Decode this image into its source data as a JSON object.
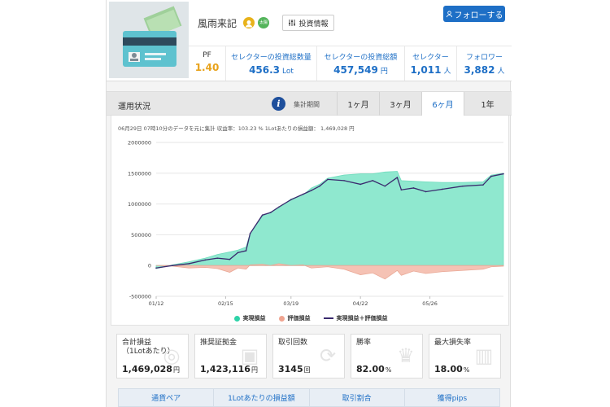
{
  "profile": {
    "name": "風雨来記",
    "badge2_text": "太陽光",
    "invest_info_label": "投資情報",
    "follow_label": "フォローする"
  },
  "stats": [
    {
      "label": "PF",
      "value": "1.40",
      "unit": ""
    },
    {
      "label": "セレクターの投資総数量",
      "value": "456.3",
      "unit": "Lot"
    },
    {
      "label": "セレクターの投資総額",
      "value": "457,549",
      "unit": "円"
    },
    {
      "label": "セレクター",
      "value": "1,011",
      "unit": "人"
    },
    {
      "label": "フォロワー",
      "value": "3,882",
      "unit": "人"
    }
  ],
  "status": {
    "title": "運用状況",
    "period_label": "集計期間",
    "tabs": [
      "1ヶ月",
      "3ヶ月",
      "6ヶ月",
      "1年"
    ],
    "active_tab": "6ヶ月"
  },
  "chart_note": "06月29日 07時10分のデータを元に集計 収益率：103.23 % 1Lotあたりの損益額： 1,469,028 円",
  "colors": {
    "realized": "#8fe8cf",
    "unrealized": "#f5c2b4",
    "combined_line": "#3a2a6e",
    "accent": "#1e6fc6"
  },
  "chart_data": {
    "type": "area",
    "title": "",
    "xlabel": "",
    "ylabel": "",
    "ylim": [
      -500000,
      2000000
    ],
    "y_ticks": [
      "2000000",
      "1500000",
      "1000000",
      "500000",
      "0",
      "-500000"
    ],
    "x_ticks": [
      "01/12",
      "02/15",
      "03/19",
      "04/22",
      "05/26"
    ],
    "x_tick_days": [
      0,
      34,
      66,
      100,
      134
    ],
    "x_range_days": [
      0,
      170
    ],
    "legend_position": "bottom",
    "series": [
      {
        "name": "実現損益",
        "kind": "area",
        "x": [
          0,
          8,
          16,
          24,
          30,
          36,
          40,
          44,
          46,
          52,
          56,
          60,
          66,
          72,
          76,
          80,
          84,
          92,
          100,
          106,
          112,
          118,
          120,
          126,
          132,
          140,
          150,
          160,
          164,
          170
        ],
        "y": [
          -50000,
          10000,
          60000,
          120000,
          180000,
          220000,
          250000,
          300000,
          520000,
          800000,
          870000,
          930000,
          1080000,
          1150000,
          1260000,
          1320000,
          1420000,
          1470000,
          1490000,
          1490000,
          1520000,
          1530000,
          1380000,
          1370000,
          1360000,
          1350000,
          1350000,
          1360000,
          1470000,
          1500000
        ]
      },
      {
        "name": "評価損益",
        "kind": "area",
        "x": [
          0,
          8,
          16,
          24,
          30,
          36,
          40,
          44,
          46,
          52,
          56,
          60,
          66,
          72,
          76,
          80,
          84,
          92,
          100,
          106,
          112,
          118,
          120,
          126,
          132,
          140,
          150,
          160,
          164,
          170
        ],
        "y": [
          0,
          -10000,
          -40000,
          -30000,
          -50000,
          -110000,
          -40000,
          -60000,
          10000,
          20000,
          0,
          30000,
          0,
          10000,
          -40000,
          -30000,
          -20000,
          -60000,
          -150000,
          -120000,
          -220000,
          -80000,
          -160000,
          -90000,
          -130000,
          -100000,
          -80000,
          -60000,
          -20000,
          -10000
        ]
      },
      {
        "name": "実現損益＋評価損益",
        "kind": "line",
        "x": [
          0,
          8,
          16,
          24,
          30,
          36,
          40,
          44,
          46,
          52,
          56,
          60,
          66,
          72,
          76,
          80,
          84,
          92,
          100,
          106,
          112,
          118,
          120,
          126,
          132,
          140,
          150,
          160,
          164,
          170
        ],
        "y": [
          -40000,
          0,
          30000,
          90000,
          120000,
          100000,
          210000,
          240000,
          520000,
          820000,
          860000,
          950000,
          1070000,
          1160000,
          1220000,
          1290000,
          1400000,
          1380000,
          1320000,
          1380000,
          1290000,
          1430000,
          1230000,
          1260000,
          1200000,
          1240000,
          1290000,
          1310000,
          1450000,
          1490000
        ]
      }
    ]
  },
  "metrics": [
    {
      "label": "合計損益\n（1Lotあたり）",
      "value": "1,469,028",
      "unit": "円",
      "icon": "coins-icon"
    },
    {
      "label": "推奨証拠金",
      "value": "1,423,116",
      "unit": "円",
      "icon": "wallet-icon"
    },
    {
      "label": "取引回数",
      "value": "3145",
      "unit": "回",
      "icon": "exchange-icon"
    },
    {
      "label": "勝率",
      "value": "82.00",
      "unit": "%",
      "icon": "trophy-icon"
    },
    {
      "label": "最大損失率",
      "value": "18.00",
      "unit": "%",
      "icon": "bar-chart-icon"
    }
  ],
  "bottom_tabs": [
    "通貨ペア",
    "1Lotあたりの損益額",
    "取引割合",
    "獲得pips"
  ]
}
